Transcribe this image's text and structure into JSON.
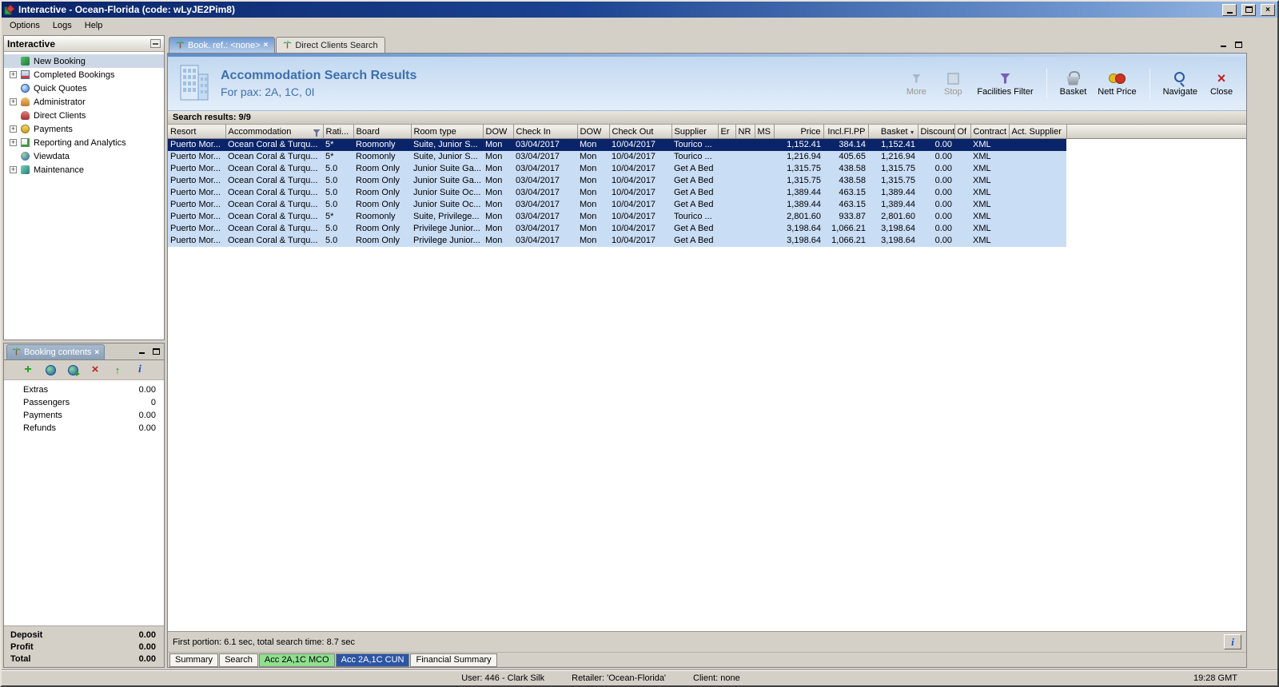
{
  "titlebar": {
    "title": "Interactive - Ocean-Florida (code: wLyJE2Pim8)"
  },
  "menubar": {
    "items": [
      "Options",
      "Logs",
      "Help"
    ]
  },
  "sidebar": {
    "title": "Interactive",
    "items": [
      {
        "label": "New Booking",
        "icon": "new-booking-icon",
        "expandable": false,
        "selected": true
      },
      {
        "label": "Completed Bookings",
        "icon": "completed-bookings-icon",
        "expandable": true,
        "selected": false
      },
      {
        "label": "Quick Quotes",
        "icon": "quick-quotes-icon",
        "expandable": false,
        "selected": false
      },
      {
        "label": "Administrator",
        "icon": "administrator-icon",
        "expandable": true,
        "selected": false
      },
      {
        "label": "Direct Clients",
        "icon": "direct-clients-icon",
        "expandable": false,
        "selected": false
      },
      {
        "label": "Payments",
        "icon": "payments-icon",
        "expandable": true,
        "selected": false
      },
      {
        "label": "Reporting and Analytics",
        "icon": "reporting-icon",
        "expandable": true,
        "selected": false
      },
      {
        "label": "Viewdata",
        "icon": "viewdata-icon",
        "expandable": false,
        "selected": false
      },
      {
        "label": "Maintenance",
        "icon": "maintenance-icon",
        "expandable": true,
        "selected": false
      }
    ]
  },
  "booking_contents": {
    "title": "Booking contents",
    "toolbar_icons": [
      "add-icon",
      "world-icon",
      "world-export-icon",
      "delete-icon",
      "promote-icon",
      "info-icon"
    ],
    "rows": [
      {
        "label": "Extras",
        "value": "0.00"
      },
      {
        "label": "Passengers",
        "value": "0"
      },
      {
        "label": "Payments",
        "value": "0.00"
      },
      {
        "label": "Refunds",
        "value": "0.00"
      }
    ],
    "totals": [
      {
        "label": "Deposit",
        "value": "0.00"
      },
      {
        "label": "Profit",
        "value": "0.00"
      },
      {
        "label": "Total",
        "value": "0.00"
      }
    ]
  },
  "main": {
    "tabs": [
      {
        "label": "Book. ref.: <none>",
        "active": true,
        "closable": true
      },
      {
        "label": "Direct Clients Search",
        "active": false,
        "closable": false
      }
    ],
    "header": {
      "title": "Accommodation Search Results",
      "subtitle": "For pax: 2A, 1C, 0I"
    },
    "toolbar": [
      {
        "label": "More",
        "icon": "more-icon",
        "disabled": true,
        "group": 1
      },
      {
        "label": "Stop",
        "icon": "stop-icon",
        "disabled": true,
        "group": 1
      },
      {
        "label": "Facilities Filter",
        "icon": "facilities-filter-icon",
        "disabled": false,
        "group": 1
      },
      {
        "label": "Basket",
        "icon": "basket-icon",
        "disabled": false,
        "group": 2
      },
      {
        "label": "Nett Price",
        "icon": "nett-price-icon",
        "disabled": false,
        "group": 2
      },
      {
        "label": "Navigate",
        "icon": "navigate-icon",
        "disabled": false,
        "group": 3
      },
      {
        "label": "Close",
        "icon": "close-x-icon",
        "disabled": false,
        "group": 3
      }
    ],
    "results_label": "Search results: 9/9",
    "table": {
      "columns": [
        {
          "label": "Resort"
        },
        {
          "label": "Accommodation",
          "filter": true
        },
        {
          "label": "Rati..."
        },
        {
          "label": "Board"
        },
        {
          "label": "Room type"
        },
        {
          "label": "DOW"
        },
        {
          "label": "Check In"
        },
        {
          "label": "DOW"
        },
        {
          "label": "Check Out"
        },
        {
          "label": "Supplier"
        },
        {
          "label": "Er"
        },
        {
          "label": "NR"
        },
        {
          "label": "MS"
        },
        {
          "label": "Price"
        },
        {
          "label": "Incl.Fl.PP"
        },
        {
          "label": "Basket",
          "sorted": true
        },
        {
          "label": "Discount"
        },
        {
          "label": "Of"
        },
        {
          "label": "Contract"
        },
        {
          "label": "Act. Supplier"
        }
      ],
      "rows": [
        {
          "selected": true,
          "cells": [
            "Puerto Mor...",
            "Ocean Coral & Turqu...",
            "5*",
            "Roomonly",
            "Suite, Junior S...",
            "Mon",
            "03/04/2017",
            "Mon",
            "10/04/2017",
            "Tourico ...",
            "",
            "",
            "",
            "1,152.41",
            "384.14",
            "1,152.41",
            "0.00",
            "",
            "XML",
            ""
          ]
        },
        {
          "selected": false,
          "cells": [
            "Puerto Mor...",
            "Ocean Coral & Turqu...",
            "5*",
            "Roomonly",
            "Suite, Junior S...",
            "Mon",
            "03/04/2017",
            "Mon",
            "10/04/2017",
            "Tourico ...",
            "",
            "",
            "",
            "1,216.94",
            "405.65",
            "1,216.94",
            "0.00",
            "",
            "XML",
            ""
          ]
        },
        {
          "selected": false,
          "cells": [
            "Puerto Mor...",
            "Ocean Coral & Turqu...",
            "5.0",
            "Room Only",
            "Junior Suite Ga...",
            "Mon",
            "03/04/2017",
            "Mon",
            "10/04/2017",
            "Get A Bed",
            "",
            "",
            "",
            "1,315.75",
            "438.58",
            "1,315.75",
            "0.00",
            "",
            "XML",
            ""
          ]
        },
        {
          "selected": false,
          "cells": [
            "Puerto Mor...",
            "Ocean Coral & Turqu...",
            "5.0",
            "Room Only",
            "Junior Suite Ga...",
            "Mon",
            "03/04/2017",
            "Mon",
            "10/04/2017",
            "Get A Bed",
            "",
            "",
            "",
            "1,315.75",
            "438.58",
            "1,315.75",
            "0.00",
            "",
            "XML",
            ""
          ]
        },
        {
          "selected": false,
          "cells": [
            "Puerto Mor...",
            "Ocean Coral & Turqu...",
            "5.0",
            "Room Only",
            "Junior Suite Oc...",
            "Mon",
            "03/04/2017",
            "Mon",
            "10/04/2017",
            "Get A Bed",
            "",
            "",
            "",
            "1,389.44",
            "463.15",
            "1,389.44",
            "0.00",
            "",
            "XML",
            ""
          ]
        },
        {
          "selected": false,
          "cells": [
            "Puerto Mor...",
            "Ocean Coral & Turqu...",
            "5.0",
            "Room Only",
            "Junior Suite Oc...",
            "Mon",
            "03/04/2017",
            "Mon",
            "10/04/2017",
            "Get A Bed",
            "",
            "",
            "",
            "1,389.44",
            "463.15",
            "1,389.44",
            "0.00",
            "",
            "XML",
            ""
          ]
        },
        {
          "selected": false,
          "cells": [
            "Puerto Mor...",
            "Ocean Coral & Turqu...",
            "5*",
            "Roomonly",
            "Suite, Privilege...",
            "Mon",
            "03/04/2017",
            "Mon",
            "10/04/2017",
            "Tourico ...",
            "",
            "",
            "",
            "2,801.60",
            "933.87",
            "2,801.60",
            "0.00",
            "",
            "XML",
            ""
          ]
        },
        {
          "selected": false,
          "cells": [
            "Puerto Mor...",
            "Ocean Coral & Turqu...",
            "5.0",
            "Room Only",
            "Privilege Junior...",
            "Mon",
            "03/04/2017",
            "Mon",
            "10/04/2017",
            "Get A Bed",
            "",
            "",
            "",
            "3,198.64",
            "1,066.21",
            "3,198.64",
            "0.00",
            "",
            "XML",
            ""
          ]
        },
        {
          "selected": false,
          "cells": [
            "Puerto Mor...",
            "Ocean Coral & Turqu...",
            "5.0",
            "Room Only",
            "Privilege Junior...",
            "Mon",
            "03/04/2017",
            "Mon",
            "10/04/2017",
            "Get A Bed",
            "",
            "",
            "",
            "3,198.64",
            "1,066.21",
            "3,198.64",
            "0.00",
            "",
            "XML",
            ""
          ]
        }
      ]
    },
    "status_text": "First portion: 6.1 sec, total search time: 8.7 sec",
    "info_button": "i",
    "bottom_tabs": [
      {
        "label": "Summary",
        "highlight": "",
        "active": false
      },
      {
        "label": "Search",
        "highlight": "",
        "active": false
      },
      {
        "label": "Acc 2A,1C MCO",
        "highlight": "green",
        "active": false
      },
      {
        "label": "Acc 2A,1C CUN",
        "highlight": "blue",
        "active": true
      },
      {
        "label": "Financial Summary",
        "highlight": "",
        "active": false
      }
    ]
  },
  "statusbar": {
    "segments": [
      "User: 446 - Clark Silk",
      "Retailer: 'Ocean-Florida'",
      "Client: none"
    ],
    "time": "19:28 GMT"
  }
}
